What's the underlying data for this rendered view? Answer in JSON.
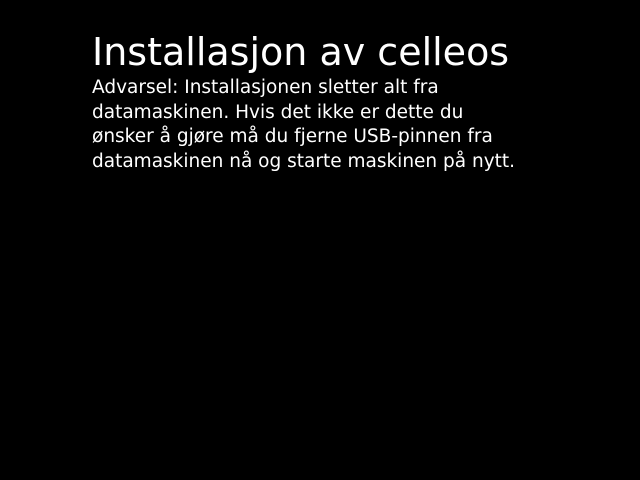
{
  "installer": {
    "title": "Installasjon av celleos",
    "warning_lines": [
      "Advarsel: Installasjonen sletter alt fra",
      "datamaskinen. Hvis det ikke er dette du",
      "ønsker å gjøre må du fjerne USB-pinnen fra",
      "datamaskinen nå og starte maskinen på nytt."
    ]
  },
  "colors": {
    "background": "#000000",
    "text": "#ffffff"
  }
}
